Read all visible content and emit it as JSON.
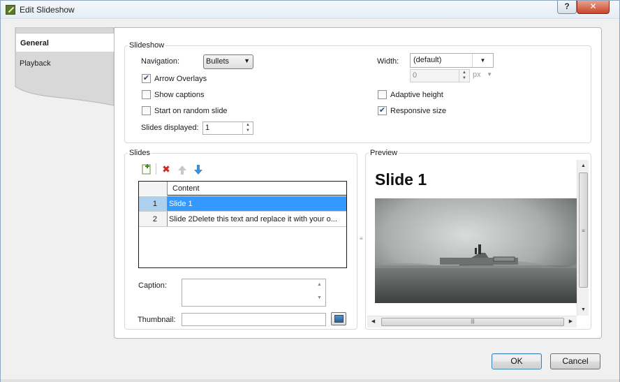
{
  "window": {
    "title": "Edit Slideshow",
    "help_label": "?",
    "close_label": "✕"
  },
  "tabs": [
    {
      "label": "General",
      "active": true
    },
    {
      "label": "Playback",
      "active": false
    }
  ],
  "slideshow": {
    "legend": "Slideshow",
    "navigation_label": "Navigation:",
    "navigation_value": "Bullets",
    "arrow_overlays": {
      "label": "Arrow Overlays",
      "checked": true
    },
    "show_captions": {
      "label": "Show captions",
      "checked": false
    },
    "random_start": {
      "label": "Start on random slide",
      "checked": false
    },
    "slides_displayed_label": "Slides displayed:",
    "slides_displayed_value": "1",
    "width_label": "Width:",
    "width_value": "(default)",
    "width_number": "0",
    "width_unit": "px",
    "adaptive_height": {
      "label": "Adaptive height",
      "checked": false
    },
    "responsive_size": {
      "label": "Responsive size",
      "checked": true
    }
  },
  "slides": {
    "legend": "Slides",
    "column_header": "Content",
    "rows": [
      {
        "num": "1",
        "content": "Slide 1",
        "selected": true
      },
      {
        "num": "2",
        "content": "Slide 2Delete this text and replace it with your o...",
        "selected": false
      }
    ],
    "caption_label": "Caption:",
    "caption_value": "",
    "thumbnail_label": "Thumbnail:",
    "thumbnail_value": ""
  },
  "preview": {
    "legend": "Preview",
    "slide_title": "Slide 1"
  },
  "buttons": {
    "ok": "OK",
    "cancel": "Cancel"
  },
  "icons": {
    "add": "add-slide-icon",
    "delete": "delete-icon",
    "up": "move-up-icon",
    "down": "move-down-icon"
  }
}
